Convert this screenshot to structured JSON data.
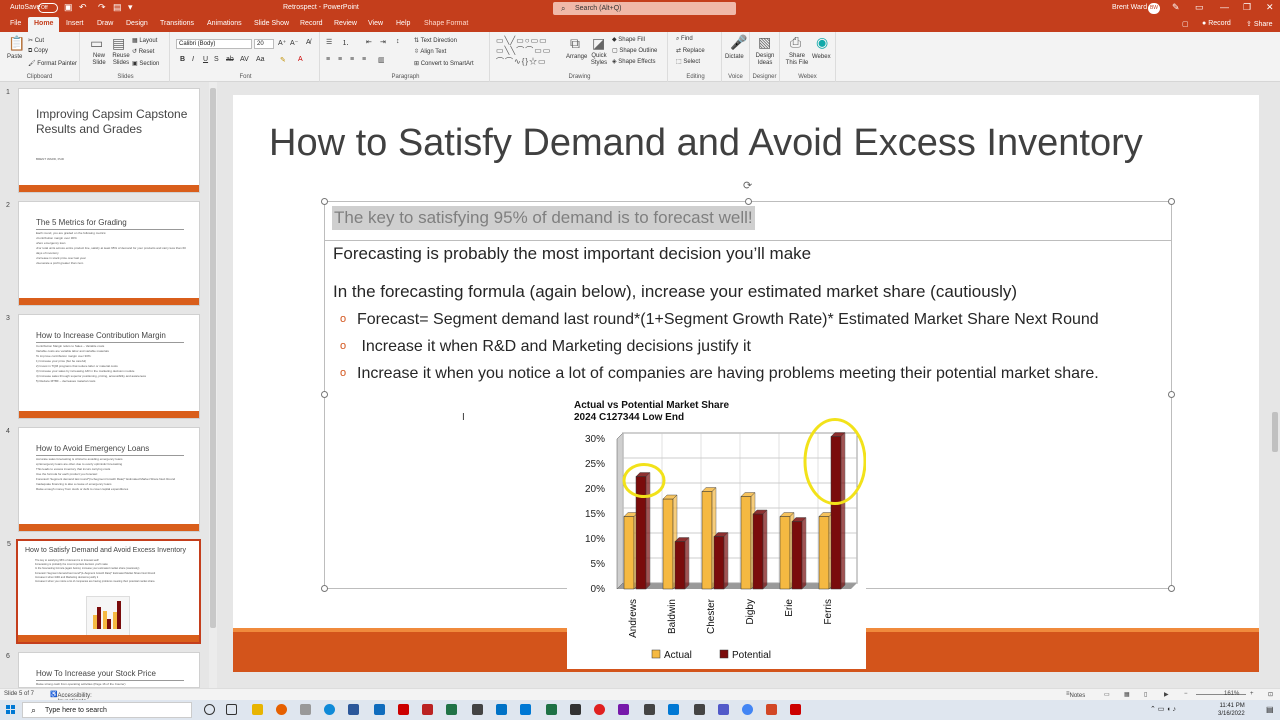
{
  "titlebar": {
    "autosave_label": "AutoSave",
    "autosave_state": "Off",
    "title": "Retrospect - PowerPoint",
    "search_placeholder": "Search (Alt+Q)",
    "user_name": "Brent Ward",
    "user_initials": "BW"
  },
  "tabs": [
    "File",
    "Home",
    "Insert",
    "Draw",
    "Design",
    "Transitions",
    "Animations",
    "Slide Show",
    "Record",
    "Review",
    "View",
    "Help",
    "Shape Format"
  ],
  "tabs_right": {
    "record": "Record",
    "share": "Share"
  },
  "ribbon": {
    "clipboard": {
      "label": "Clipboard",
      "paste": "Paste",
      "cut": "Cut",
      "copy": "Copy",
      "format_painter": "Format Painter"
    },
    "slides": {
      "label": "Slides",
      "new_slide": "New Slide",
      "reuse_slides": "Reuse Slides",
      "layout": "Layout",
      "reset": "Reset",
      "section": "Section"
    },
    "font": {
      "label": "Font",
      "family": "Calibri (Body)",
      "size": "20"
    },
    "paragraph": {
      "label": "Paragraph",
      "text_direction": "Text Direction",
      "align_text": "Align Text",
      "smartart": "Convert to SmartArt"
    },
    "drawing": {
      "label": "Drawing",
      "arrange": "Arrange",
      "quick_styles": "Quick Styles",
      "shape_fill": "Shape Fill",
      "shape_outline": "Shape Outline",
      "shape_effects": "Shape Effects"
    },
    "editing": {
      "label": "Editing",
      "find": "Find",
      "replace": "Replace",
      "select": "Select"
    },
    "voice": {
      "label": "Voice",
      "dictate": "Dictate"
    },
    "designer": {
      "label": "Designer",
      "design_ideas": "Design Ideas"
    },
    "webex": {
      "label": "Webex",
      "share_file": "Share This File",
      "webex": "Webex"
    }
  },
  "thumbnails": [
    {
      "num": "1",
      "title": "Improving Capsim Capstone Results and Grades",
      "sub": "BRENT WARD, PHD"
    },
    {
      "num": "2",
      "title": "The 5 Metrics for Grading",
      "body": "Each round, you are graded on the following metrics:\n•Contribution margin over 30%\n•Zero emergency loan\n•For total units across entire product line, satisfy at least 95% of demand for your products and carry less than 60 days of inventory\n•Increase in stock price over last year\n•Generate a profit greater than zero"
    },
    {
      "num": "3",
      "title": "How to Increase Contribution Margin",
      "body": "Contribution Margin refers to Sales – Variable costs\nVariable costs are variable labor and variable materials\nTo improve contribution margin over 30%:\n1) Increase your price (but be careful)\n2) Invest in TQM programs that reduce labor or material costs\n3) Increase your sales by increasing A/R in the marketing decision module\n4) Increase sales through superior positioning, pricing, accessibility and awareness\n5) Reduce MTBF – decreases material costs"
    },
    {
      "num": "4",
      "title": "How to Avoid Emergency Loans",
      "body": "Accurate sales forecasting is critical to avoiding emergency loans\na) Emergency loans are often due to overly optimistic forecasting\nThis leads to excess inventory that incurs carrying costs\nUse the formula for each product you forecast:\nForecast= Segment demand last round*(1+Segment Growth Rate)* Estimated Market Share Next Round\nInadequate financing is also a cause of emergency loans\nRaise enough money from stock or debt to cover capital expenditures"
    },
    {
      "num": "5",
      "title": "How to Satisfy Demand and Avoid Excess Inventory",
      "body": "The key to satisfying 95% of demand is to forecast well!\nForecasting is probably the most important decision you'll make\nIn the forecasting formula (again below), increase your estimated market share (cautiously)\nForecast= Segment demand last round*(1+Segment Growth Rate)* Estimated Market Share Next Round\nIncrease it when R&D and Marketing decisions justify it\nIncrease it when you notice a lot of companies are having problems meeting their potential market share."
    },
    {
      "num": "6",
      "title": "How To Increase your Stock Price",
      "body": "Raise strong cash from operating activities (Page 16 of the Courier)"
    }
  ],
  "slide": {
    "title": "How to Satisfy Demand and Avoid Excess Inventory",
    "highlight": "The key to satisfying 95% of demand is to forecast well!",
    "para1": "Forecasting is probably the most important decision you’ll make",
    "para2": "In the forecasting formula (again below), increase your estimated market share (cautiously)",
    "bullet1": "Forecast= Segment demand last round*(1+Segment Growth Rate)* Estimated Market Share Next Round",
    "bullet2": " Increase it when R&D and Marketing decisions justify it",
    "bullet3": "Increase it when you notice a lot of companies are having problems meeting their potential market share.",
    "bullet_marker": "o"
  },
  "chart_data": {
    "type": "bar",
    "title": "Actual vs Potential Market Share",
    "subtitle": "2024 C127344 Low End",
    "categories": [
      "Andrews",
      "Baldwin",
      "Chester",
      "Digby",
      "Erie",
      "Ferris"
    ],
    "series": [
      {
        "name": "Actual",
        "color": "#f5b942",
        "values": [
          14.5,
          18,
          19.5,
          18.5,
          14.5,
          14.5
        ]
      },
      {
        "name": "Potential",
        "color": "#7a0c0c",
        "values": [
          22.5,
          9.5,
          10.5,
          15,
          13.5,
          30.5
        ]
      }
    ],
    "ylim": [
      0,
      30
    ],
    "yticks": [
      "0%",
      "5%",
      "10%",
      "15%",
      "20%",
      "25%",
      "30%"
    ],
    "legend": "bottom",
    "annotation_color": "#f2e21a"
  },
  "statusbar": {
    "slide_info": "Slide 5 of 7",
    "accessibility": "Accessibility: Investigate",
    "notes": "Notes",
    "zoom": "161%"
  },
  "taskbar": {
    "search_placeholder": "Type here to search",
    "time": "11:41 PM",
    "date": "3/16/2022"
  },
  "colors": {
    "accent": "#c43e1c",
    "slide_orange": "#d3541b"
  }
}
